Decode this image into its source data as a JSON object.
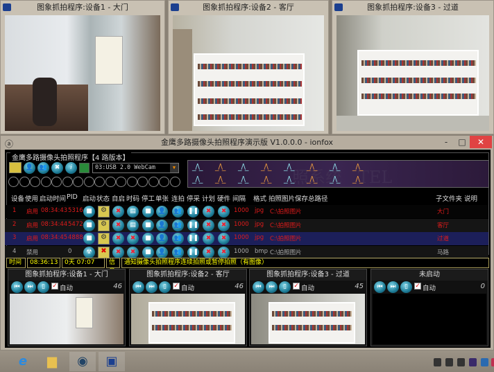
{
  "camera_windows": [
    {
      "title": "图象抓拍程序:设备1 - 大门"
    },
    {
      "title": "图象抓拍程序:设备2 - 客厅"
    },
    {
      "title": "图象抓拍程序:设备3 - 过道"
    }
  ],
  "main_window": {
    "title": "金鹰多路摄像头拍照程序演示版 V1.0.0.0 - ionfox",
    "minimize": "-",
    "maximize": "□",
    "close": "✕",
    "group_title": "金鹰多路摄像头拍照程序【4 路版本】",
    "camera_select": "03:USB 2.0 WebCam",
    "banner_text": "照系统   TEL",
    "columns": [
      "设备",
      "使用",
      "启动时间",
      "PID",
      "启动",
      "状态",
      "自启",
      "时码",
      "停工",
      "单张",
      "连拍",
      "停采",
      "计划",
      "硬件",
      "间隔",
      "格式",
      "拍照图片保存总路径",
      "子文件夹",
      "说明"
    ],
    "rows": [
      {
        "device": "1",
        "use": "启用",
        "start_time": "08:34:43",
        "pid": "5316",
        "interval": "1000",
        "format": "jpg",
        "path": "C:\\拍照图片",
        "subfolder": "大门",
        "note": "",
        "active": true,
        "selected": false
      },
      {
        "device": "2",
        "use": "启用",
        "start_time": "08:34:44",
        "pid": "5472",
        "interval": "1000",
        "format": "jpg",
        "path": "C:\\拍照图片",
        "subfolder": "客厅",
        "note": "",
        "active": true,
        "selected": false
      },
      {
        "device": "3",
        "use": "启用",
        "start_time": "08:34:45",
        "pid": "4888",
        "interval": "1000",
        "format": "jpg",
        "path": "C:\\拍照图片",
        "subfolder": "过道",
        "note": "",
        "active": true,
        "selected": true
      },
      {
        "device": "4",
        "use": "禁用",
        "start_time": "",
        "pid": "0",
        "interval": "1000",
        "format": "bmp",
        "path": "C:\\拍照图片",
        "subfolder": "马路",
        "note": "",
        "active": false,
        "selected": false
      }
    ],
    "status": {
      "time_label": "时间",
      "time": "08:36:13",
      "uptime": "0天 07:07",
      "info_label": "信息",
      "message": "通知摄像头拍照程序连续拍照或暂停拍照（有图像）"
    },
    "previews": [
      {
        "title": "图象抓拍程序:设备1 - 大门",
        "auto_label": "自动",
        "auto": true,
        "count": "46"
      },
      {
        "title": "图象抓拍程序:设备2 - 客厅",
        "auto_label": "自动",
        "auto": true,
        "count": "46"
      },
      {
        "title": "图象抓拍程序:设备3 - 过道",
        "auto_label": "自动",
        "auto": true,
        "count": "45"
      },
      {
        "title": "未启动",
        "auto_label": "自动",
        "auto": true,
        "count": "0"
      }
    ]
  },
  "colors": {
    "active_text": "#e01b1b",
    "selected_row": "#1c1f5a",
    "status_text": "#ffff00",
    "close_button": "#e04343"
  }
}
